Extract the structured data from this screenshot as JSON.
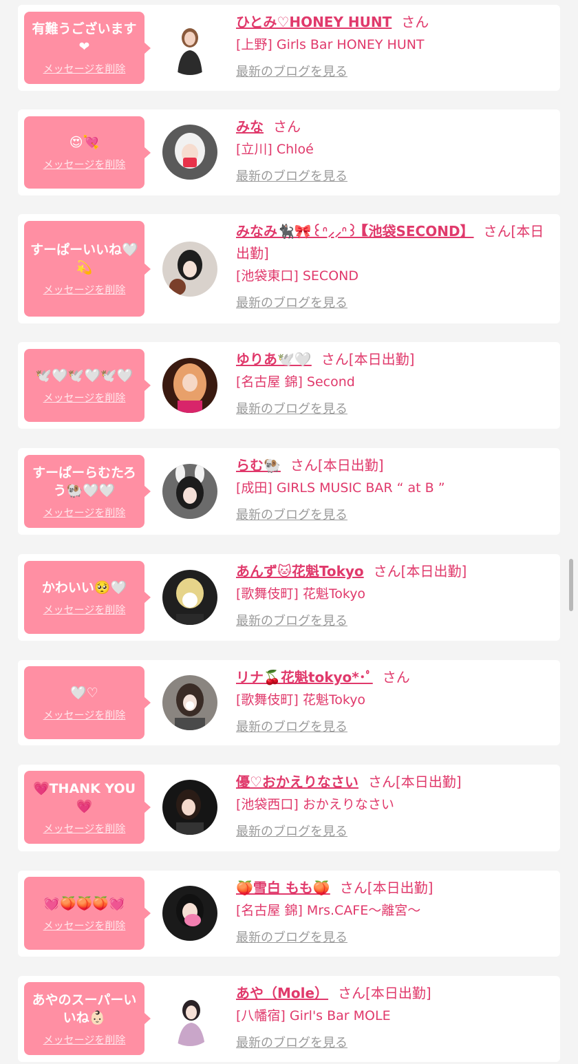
{
  "delete_label": "メッセージを削除",
  "blog_label": "最新のブログを見る",
  "colors": {
    "bubble": "#ff8fa3",
    "name": "#e0396b",
    "link_gray": "#9a9a9a",
    "background": "#f4f4f4"
  },
  "messages": [
    {
      "message": "有難うございます❤︎",
      "name": "ひとみ♡HONEY HUNT",
      "suffix": "さん",
      "shop": "[上野] Girls Bar HONEY HUNT"
    },
    {
      "message": "😍💘",
      "name": "みな",
      "suffix": "さん",
      "shop": "[立川] Chloé"
    },
    {
      "message": "すーぱーいいね🤍💫",
      "name": "みなみ🐈‍⬛🎀꒰ᐢ⸝⸝ᐢ꒱【池袋SECOND】",
      "suffix": "さん[本日出勤]",
      "shop": "[池袋東口] SECOND"
    },
    {
      "message": "🕊️🤍🕊️🤍🕊️🤍",
      "name": "ゆりあ🕊️🤍",
      "suffix": "さん[本日出勤]",
      "shop": "[名古屋 錦] Second"
    },
    {
      "message": "すーぱーらむたろう🐏🤍🤍",
      "name": "らむ🐏",
      "suffix": "さん[本日出勤]",
      "shop": "[成田] GIRLS MUSIC BAR “ at B ”"
    },
    {
      "message": "かわいい🥺🤍",
      "name": "あんず🐱花魁Tokyo",
      "suffix": "さん[本日出勤]",
      "shop": "[歌舞伎町] 花魁Tokyo"
    },
    {
      "message": "🤍♡",
      "name": "リナ🍒花魁tokyo*･ﾟ",
      "suffix": "さん",
      "shop": "[歌舞伎町] 花魁Tokyo"
    },
    {
      "message": "💗THANK YOU💗",
      "name": "優♡おかえりなさい",
      "suffix": "さん[本日出勤]",
      "shop": "[池袋西口] おかえりなさい"
    },
    {
      "message": "💓🍑🍑🍑💓",
      "name": "🍑雪白 もも🍑",
      "suffix": "さん[本日出勤]",
      "shop": "[名古屋 錦] Mrs.CAFE〜離宮〜"
    },
    {
      "message": "あやのスーパーいいね👶🏻",
      "name": "あや（Mole）",
      "suffix": "さん[本日出勤]",
      "shop": "[八幡宿] Girl's Bar MOLE"
    }
  ]
}
